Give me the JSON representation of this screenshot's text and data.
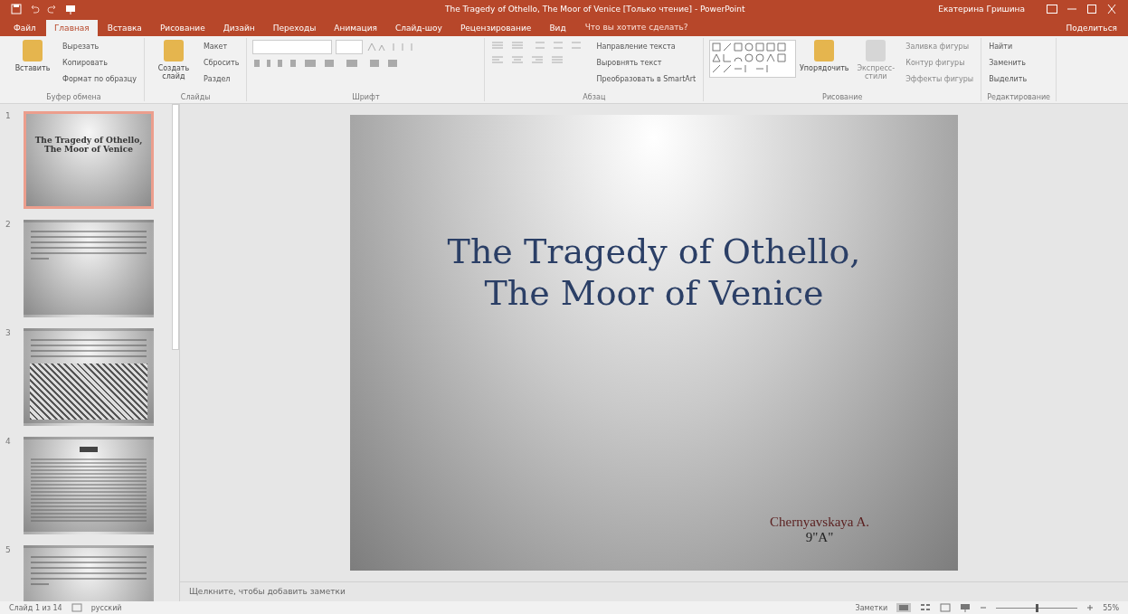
{
  "window": {
    "title": "The Tragedy of Othello, The Moor of Venice [Только чтение] - PowerPoint",
    "user": "Екатерина Гришина"
  },
  "tabs": [
    {
      "label": "Файл",
      "selected": false
    },
    {
      "label": "Главная",
      "selected": true
    },
    {
      "label": "Вставка",
      "selected": false
    },
    {
      "label": "Рисование",
      "selected": false
    },
    {
      "label": "Дизайн",
      "selected": false
    },
    {
      "label": "Переходы",
      "selected": false
    },
    {
      "label": "Анимация",
      "selected": false
    },
    {
      "label": "Слайд-шоу",
      "selected": false
    },
    {
      "label": "Рецензирование",
      "selected": false
    },
    {
      "label": "Вид",
      "selected": false
    }
  ],
  "tell_me": "Что вы хотите сделать?",
  "share": "Поделиться",
  "ribbon": [
    {
      "label": "Буфер обмена",
      "kind": "clipboard",
      "large": "Вставить",
      "items": [
        "Вырезать",
        "Копировать",
        "Формат по образцу"
      ]
    },
    {
      "label": "Слайды",
      "kind": "slides",
      "large": "Создать слайд",
      "items": [
        "Макет",
        "Сбросить",
        "Раздел"
      ]
    },
    {
      "label": "Шрифт",
      "kind": "font"
    },
    {
      "label": "Абзац",
      "kind": "paragraph",
      "items": [
        "Направление текста",
        "Выровнять текст",
        "Преобразовать в SmartArt"
      ]
    },
    {
      "label": "Рисование",
      "kind": "drawing",
      "large": "Упорядочить",
      "large2": "Экспресс-стили",
      "items": [
        "Заливка фигуры",
        "Контур фигуры",
        "Эффекты фигуры"
      ]
    },
    {
      "label": "Редактирование",
      "kind": "editing",
      "items": [
        "Найти",
        "Заменить",
        "Выделить"
      ]
    }
  ],
  "slides": [
    {
      "number": "1",
      "selected": true,
      "kind": "title",
      "title_lines": [
        "The Tragedy of Othello,",
        "The Moor of Venice"
      ]
    },
    {
      "number": "2",
      "selected": false,
      "kind": "text"
    },
    {
      "number": "3",
      "selected": false,
      "kind": "text-image"
    },
    {
      "number": "4",
      "selected": false,
      "kind": "heading-text"
    },
    {
      "number": "5",
      "selected": false,
      "kind": "text"
    }
  ],
  "slide": {
    "title_lines": [
      "The Tragedy of Othello,",
      "The Moor of Venice"
    ],
    "author": "Chernyavskaya A.",
    "class": "9\"A\""
  },
  "notes": {
    "placeholder": "Щелкните, чтобы добавить заметки"
  },
  "status_bar": {
    "slide": "Слайд 1 из 14",
    "language": "русский",
    "notes": "Заметки",
    "zoom": "55%",
    "level": 0.5
  }
}
